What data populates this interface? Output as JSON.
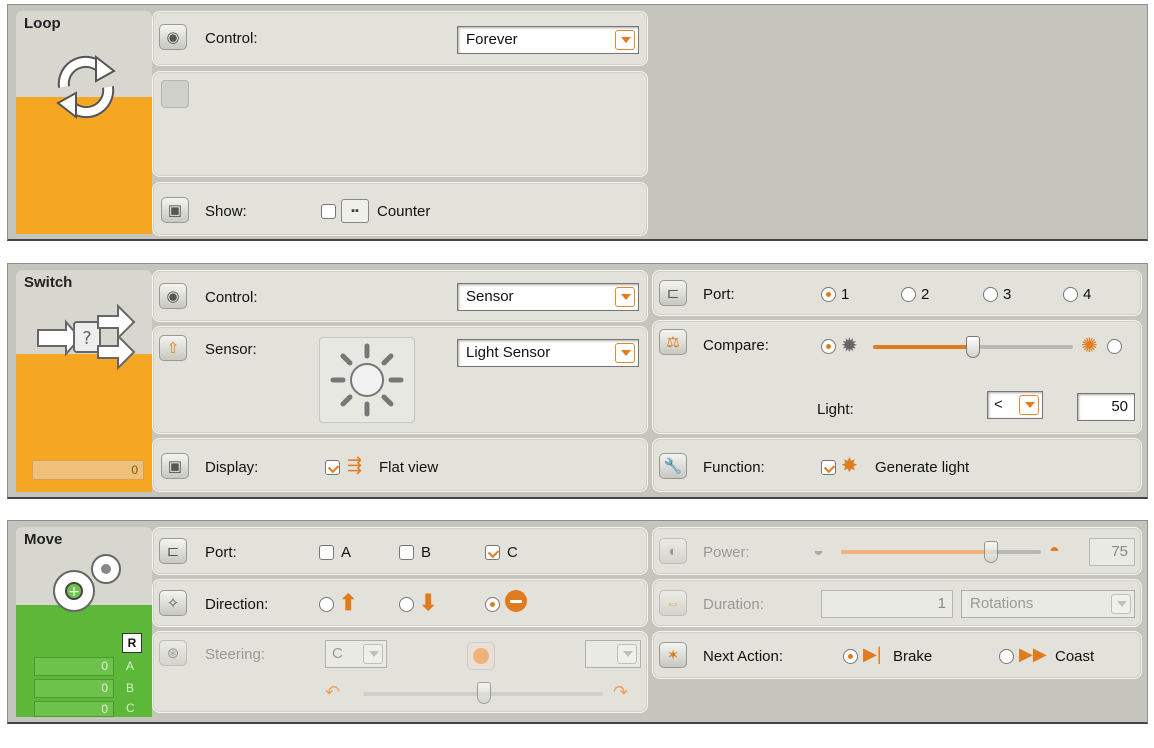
{
  "loop": {
    "title": "Loop",
    "control_label": "Control:",
    "control_value": "Forever",
    "show_label": "Show:",
    "counter_label": "Counter",
    "counter_checked": false,
    "accent_color": "#f5a623"
  },
  "switch": {
    "title": "Switch",
    "control_label": "Control:",
    "control_value": "Sensor",
    "sensor_label": "Sensor:",
    "sensor_value": "Light Sensor",
    "display_label": "Display:",
    "flat_view_label": "Flat view",
    "flat_view_checked": true,
    "port_label": "Port:",
    "ports": [
      "1",
      "2",
      "3",
      "4"
    ],
    "port_selected": "1",
    "compare_label": "Compare:",
    "compare_selected": "dark",
    "light_label": "Light:",
    "light_operator": "<",
    "light_value": "50",
    "light_level": 50,
    "function_label": "Function:",
    "generate_light_label": "Generate light",
    "generate_light_checked": true,
    "counter_value": "0",
    "accent_color": "#f5a623"
  },
  "move": {
    "title": "Move",
    "port_label": "Port:",
    "ports": [
      {
        "label": "A",
        "checked": false
      },
      {
        "label": "B",
        "checked": false
      },
      {
        "label": "C",
        "checked": true
      }
    ],
    "direction_label": "Direction:",
    "direction_selected": "stop",
    "steering_label": "Steering:",
    "steering_left": "C",
    "steering_right": "",
    "power_label": "Power:",
    "power_value": "75",
    "power_level": 75,
    "duration_label": "Duration:",
    "duration_value": "1",
    "duration_unit": "Rotations",
    "next_action_label": "Next Action:",
    "brake_label": "Brake",
    "coast_label": "Coast",
    "next_action_selected": "Brake",
    "reset_label": "R",
    "counters": [
      {
        "value": "0",
        "port": "A"
      },
      {
        "value": "0",
        "port": "B"
      },
      {
        "value": "0",
        "port": "C"
      }
    ],
    "accent_color": "#5db83a"
  }
}
